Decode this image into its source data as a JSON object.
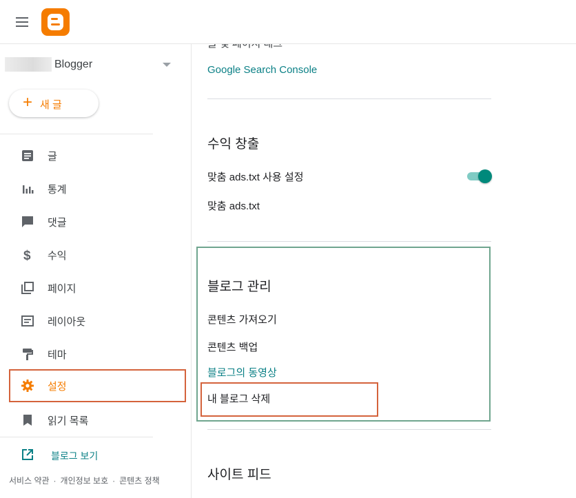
{
  "app": {
    "logo": "blogger-logo",
    "brand_color": "#f57c00"
  },
  "sidebar": {
    "blog_name": "Blogger",
    "new_post_label": "새 글",
    "items": [
      {
        "label": "글",
        "icon": "posts-icon"
      },
      {
        "label": "통계",
        "icon": "stats-icon"
      },
      {
        "label": "댓글",
        "icon": "comments-icon"
      },
      {
        "label": "수익",
        "icon": "earnings-icon"
      },
      {
        "label": "페이지",
        "icon": "pages-icon"
      },
      {
        "label": "레이아웃",
        "icon": "layout-icon"
      },
      {
        "label": "테마",
        "icon": "theme-icon"
      },
      {
        "label": "설정",
        "icon": "gear-icon",
        "active": true
      },
      {
        "label": "읽기 목록",
        "icon": "bookmark-icon"
      }
    ],
    "view_blog_label": "블로그 보기",
    "footer": {
      "terms": "서비스 약관",
      "privacy": "개인정보 보호",
      "content_policy": "콘텐츠 정책",
      "separator": "·"
    }
  },
  "main": {
    "cut_label": "글 및 페이지 태그",
    "search_console_link": "Google Search Console",
    "monetization": {
      "heading": "수익 창출",
      "custom_ads_toggle_label": "맞춤 ads.txt 사용 설정",
      "custom_ads_toggle_on": true,
      "custom_ads_label": "맞춤 ads.txt"
    },
    "manage_blog": {
      "heading": "블로그 관리",
      "import_content": "콘텐츠 가져오기",
      "backup_content": "콘텐츠 백업",
      "blog_videos_link": "블로그의 동영상",
      "delete_blog": "내 블로그 삭제"
    },
    "site_feed": {
      "heading": "사이트 피드"
    }
  },
  "colors": {
    "accent": "#f57c00",
    "link": "#0b8086",
    "toggle_on": "#00897b",
    "highlight_red": "#d4623b",
    "highlight_green": "#6fa58e"
  }
}
